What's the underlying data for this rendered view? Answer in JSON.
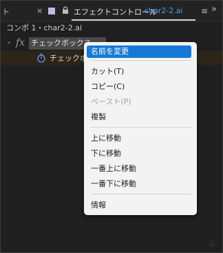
{
  "panel": {
    "left_tab_label": "ト",
    "close_glyph": "×",
    "title": "エフェクトコントロール",
    "comp_name": "char2-2.ai",
    "menu_glyph": "≡",
    "expand_glyph": "»",
    "swatch_color": "#c7b8e8",
    "accent_color": "#4f9cf6"
  },
  "breadcrumb": "コンポ 1・char2-2.ai",
  "effect": {
    "fx_label": "fx",
    "name": "チェックボックス",
    "param_label": "チェックボ"
  },
  "context_menu": {
    "items": [
      {
        "label": "名前を変更",
        "state": "highlighted"
      },
      {
        "label": "カット(T)",
        "state": "enabled"
      },
      {
        "label": "コピー(C)",
        "state": "enabled"
      },
      {
        "label": "ペースト(P)",
        "state": "disabled"
      },
      {
        "label": "複製",
        "state": "enabled"
      },
      {
        "label": "上に移動",
        "state": "enabled"
      },
      {
        "label": "下に移動",
        "state": "enabled"
      },
      {
        "label": "一番上に移動",
        "state": "enabled"
      },
      {
        "label": "一番下に移動",
        "state": "enabled"
      },
      {
        "label": "情報",
        "state": "enabled"
      }
    ]
  }
}
